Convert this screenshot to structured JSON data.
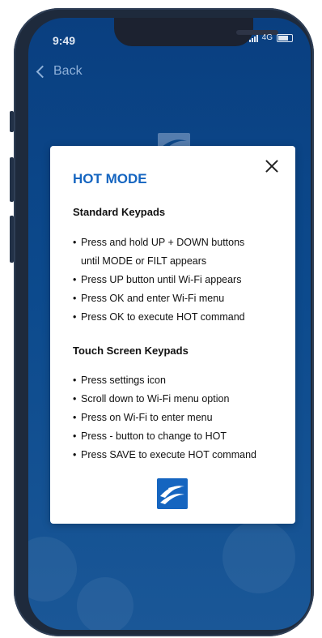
{
  "status_bar": {
    "time": "9:49",
    "network": "4G"
  },
  "nav": {
    "back_label": "Back"
  },
  "modal": {
    "title": "HOT MODE",
    "sections": [
      {
        "heading": "Standard Keypads",
        "items": [
          "Press and hold UP + DOWN buttons",
          "until MODE or FILT appears",
          "Press UP button until Wi-Fi appears",
          "Press OK and enter Wi-Fi menu",
          "Press OK to execute HOT command"
        ]
      },
      {
        "heading": "Touch Screen Keypads",
        "items": [
          "Press settings icon",
          "Scroll down to Wi-Fi menu option",
          "Press on Wi-Fi to enter menu",
          "Press - button to change to HOT",
          "Press SAVE to execute HOT command"
        ]
      }
    ],
    "close_icon": "close-icon",
    "logo_icon": "brand-logo-icon"
  },
  "colors": {
    "accent": "#1565c0",
    "background": "#0c4a8d"
  }
}
